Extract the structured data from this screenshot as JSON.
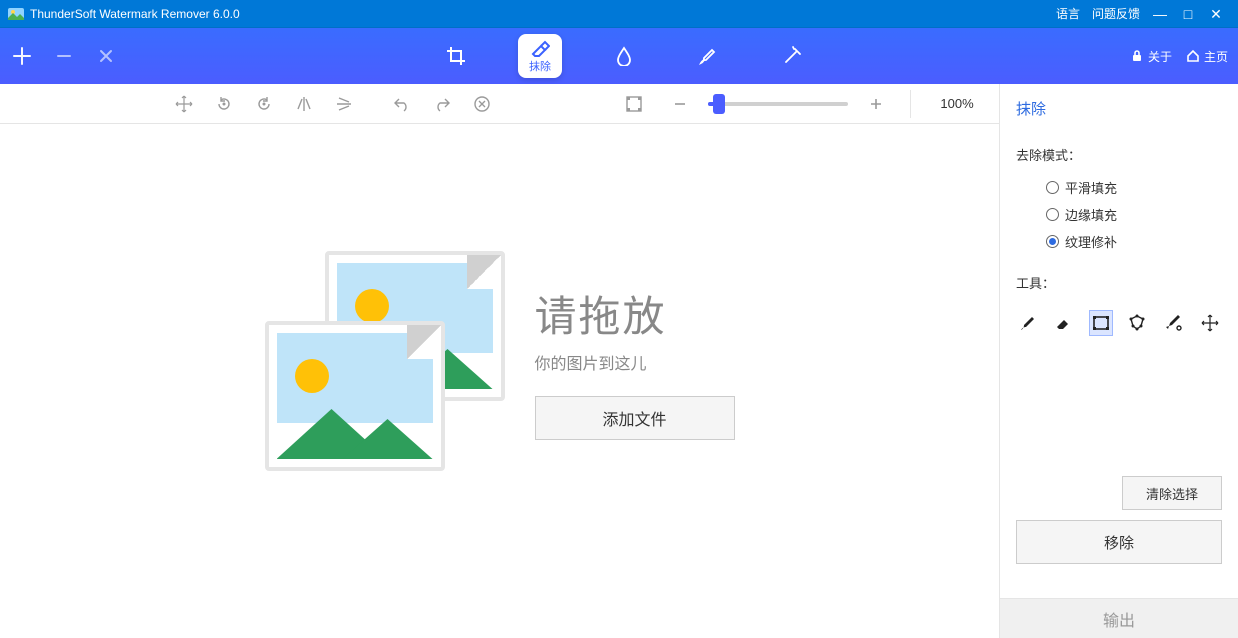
{
  "titlebar": {
    "app_title": "ThunderSoft Watermark Remover 6.0.0",
    "language": "语言",
    "feedback": "问题反馈"
  },
  "maintoolbar": {
    "tools": {
      "crop": "",
      "erase": "抹除",
      "blur": "",
      "brush": "",
      "wand": ""
    },
    "about": "关于",
    "home": "主页"
  },
  "zoom": {
    "text": "100%"
  },
  "drop": {
    "big": "请拖放",
    "sub": "你的图片到这儿",
    "add_btn": "添加文件"
  },
  "panel": {
    "title": "抹除",
    "mode_title": "去除模式：",
    "modes": {
      "smooth": "平滑填充",
      "edge": "边缘填充",
      "texture": "纹理修补"
    },
    "tools_title": "工具：",
    "clear_sel": "清除选择",
    "remove": "移除",
    "output": "输出"
  }
}
